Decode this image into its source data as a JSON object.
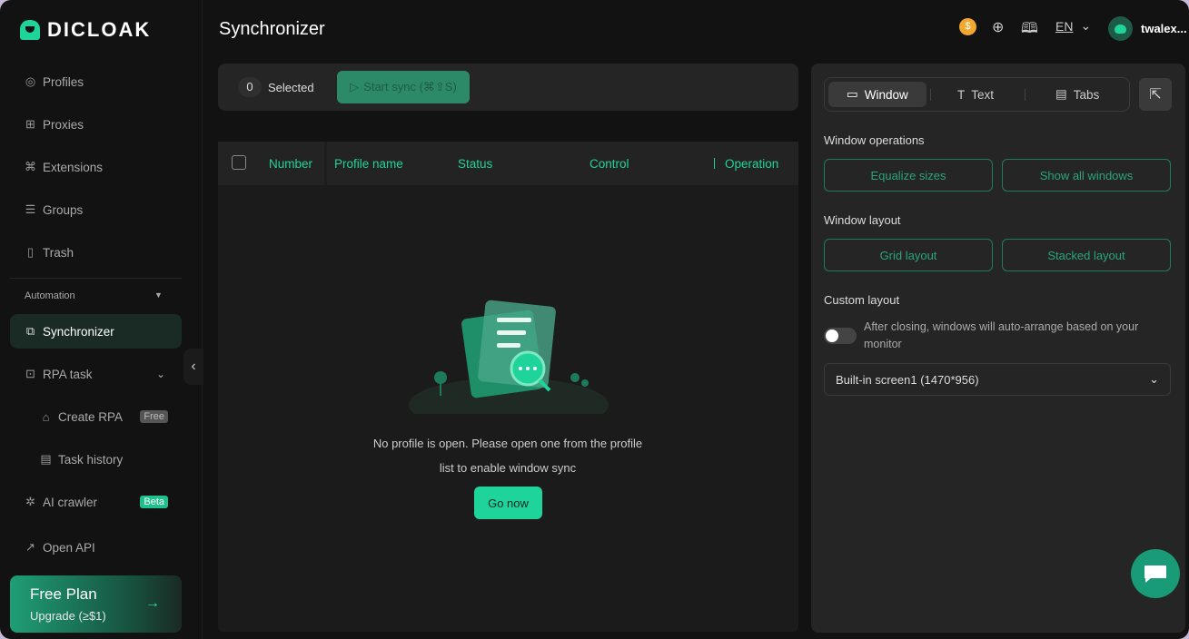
{
  "app": {
    "brand": "DICLOAK",
    "page_title": "Synchronizer"
  },
  "sidebar": {
    "items": [
      {
        "label": "Profiles",
        "icon": "chrome-icon"
      },
      {
        "label": "Proxies",
        "icon": "network-icon"
      },
      {
        "label": "Extensions",
        "icon": "command-icon"
      },
      {
        "label": "Groups",
        "icon": "groups-icon"
      },
      {
        "label": "Trash",
        "icon": "trash-icon"
      }
    ],
    "section": "Automation",
    "automation": [
      {
        "label": "Synchronizer",
        "active": true
      },
      {
        "label": "RPA task"
      },
      {
        "label": "Create RPA",
        "badge": "Free"
      },
      {
        "label": "Task history"
      },
      {
        "label": "AI crawler",
        "badge": "Beta"
      },
      {
        "label": "Open API"
      }
    ],
    "plan": {
      "title": "Free Plan",
      "subtitle": "Upgrade (≥$1)"
    }
  },
  "header": {
    "language": "EN",
    "username": "twalex..."
  },
  "toolbar": {
    "selected_count": "0",
    "selected_label": "Selected",
    "start_sync": "Start sync (⌘⇧S)"
  },
  "table": {
    "columns": [
      "Number",
      "Profile name",
      "Status",
      "Control",
      "Operation"
    ]
  },
  "empty": {
    "line1": "No profile is open. Please open one from the profile",
    "line2": "list to enable window sync",
    "button": "Go now"
  },
  "right_panel": {
    "tabs": [
      "Window",
      "Text",
      "Tabs"
    ],
    "window_operations": {
      "label": "Window operations",
      "buttons": [
        "Equalize sizes",
        "Show all windows"
      ]
    },
    "window_layout": {
      "label": "Window layout",
      "buttons": [
        "Grid layout",
        "Stacked layout"
      ]
    },
    "custom_layout": {
      "label": "Custom layout",
      "toggle_text_1": "After closing, windows will auto-arrange based on your",
      "toggle_text_2": "monitor",
      "toggle_on": false
    },
    "screen_select": "Built-in screen1 (1470*956)"
  }
}
